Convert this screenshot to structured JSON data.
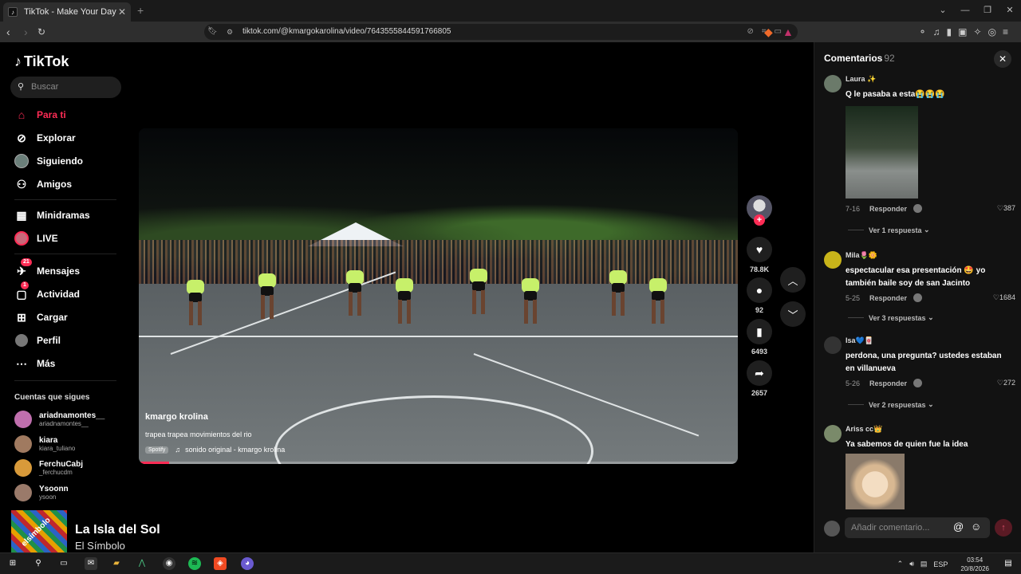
{
  "browser": {
    "tab_title": "TikTok - Make Your Day",
    "tab_close": "✕",
    "new_tab": "+",
    "url": "tiktok.com/@kmargokarolina/video/7643555844591766805"
  },
  "sidebar": {
    "logo": "TikTok",
    "search_placeholder": "Buscar",
    "nav": [
      {
        "label": "Para ti",
        "icon": "home-icon"
      },
      {
        "label": "Explorar",
        "icon": "compass-icon"
      },
      {
        "label": "Siguiendo",
        "icon": "following-avatar-icon"
      },
      {
        "label": "Amigos",
        "icon": "friends-icon"
      },
      {
        "label": "Minidramas",
        "icon": "film-icon"
      },
      {
        "label": "LIVE",
        "icon": "live-icon"
      },
      {
        "label": "Mensajes",
        "icon": "messages-icon",
        "badge": "21"
      },
      {
        "label": "Actividad",
        "icon": "activity-icon",
        "badge": "1"
      },
      {
        "label": "Cargar",
        "icon": "upload-icon"
      },
      {
        "label": "Perfil",
        "icon": "profile-icon"
      },
      {
        "label": "Más",
        "icon": "more-icon"
      }
    ],
    "following_header": "Cuentas que sigues",
    "accounts": [
      {
        "name": "ariadnamontes__",
        "user": "ariadnamontes__",
        "color": "#c06fae"
      },
      {
        "name": "kiara",
        "user": "kiara_tuliano",
        "color": "#a07a60"
      },
      {
        "name": "FerchuCabj",
        "user": "_ferchucdm",
        "color": "#d89a3a"
      },
      {
        "name": "Ysoonn",
        "user": "ysoon",
        "color": "#9a7a6a"
      }
    ]
  },
  "now_playing": {
    "title": "La Isla del Sol",
    "artist": "El Símbolo",
    "art_text": "elsímbolo"
  },
  "video": {
    "author": "kmargo krolina",
    "description": "trapea trapea movimientos del rio",
    "spotify": "Spotify",
    "music": "sonido original - kmargo krolina",
    "progress": 0.05
  },
  "actions": {
    "likes": "78.8K",
    "comments": "92",
    "saves": "6493",
    "shares": "2657"
  },
  "comments": {
    "title": "Comentarios",
    "count": "92",
    "input_placeholder": "Añadir comentario...",
    "items": [
      {
        "name": "Laura ✨",
        "text": "Q le pasaba a esta😭😭😭",
        "date": "7-16",
        "reply": "Responder",
        "likes": "387",
        "more": "Ver 1 respuesta",
        "avatar": "#6b7a6a"
      },
      {
        "name": "Mila🌷🌼",
        "text": "espectacular esa presentación 🤩 yo también baile soy de san Jacinto",
        "date": "5-25",
        "reply": "Responder",
        "likes": "1684",
        "more": "Ver 3 respuestas",
        "avatar": "#c8b41a"
      },
      {
        "name": "Isa💙🀄",
        "text": "perdona, una pregunta? ustedes estaban en villanueva",
        "date": "5-26",
        "reply": "Responder",
        "likes": "272",
        "more": "Ver 2 respuestas",
        "avatar": "#333"
      },
      {
        "name": "Ariss cc👑",
        "text": "Ya sabemos de quien fue la idea",
        "avatar": "#7a8a6a"
      }
    ]
  },
  "taskbar": {
    "lang": "ESP",
    "time": "03:54",
    "date": "20/8/2026"
  }
}
